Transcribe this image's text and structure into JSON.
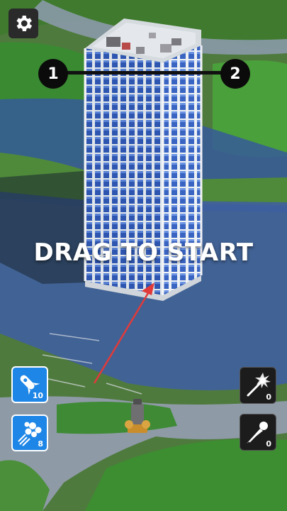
{
  "hud": {
    "settings_icon": "gear-icon",
    "level_progress": {
      "current_level": "1",
      "next_level": "2"
    },
    "prompt_text": "DRAG TO START"
  },
  "ammo": {
    "rocket": {
      "icon": "rocket-icon",
      "count": "10"
    },
    "cluster": {
      "icon": "cluster-balls-icon",
      "count": "8"
    }
  },
  "powerups": {
    "fire_wand": {
      "icon": "fire-wand-icon",
      "count": "0"
    },
    "meteor": {
      "icon": "meteor-icon",
      "count": "0"
    }
  },
  "colors": {
    "ammo_blue": "#1e86e6",
    "aim_arrow": "#e03a3a",
    "tower_glass": "#2a4fa8",
    "tower_frame": "#e8ecf0"
  }
}
